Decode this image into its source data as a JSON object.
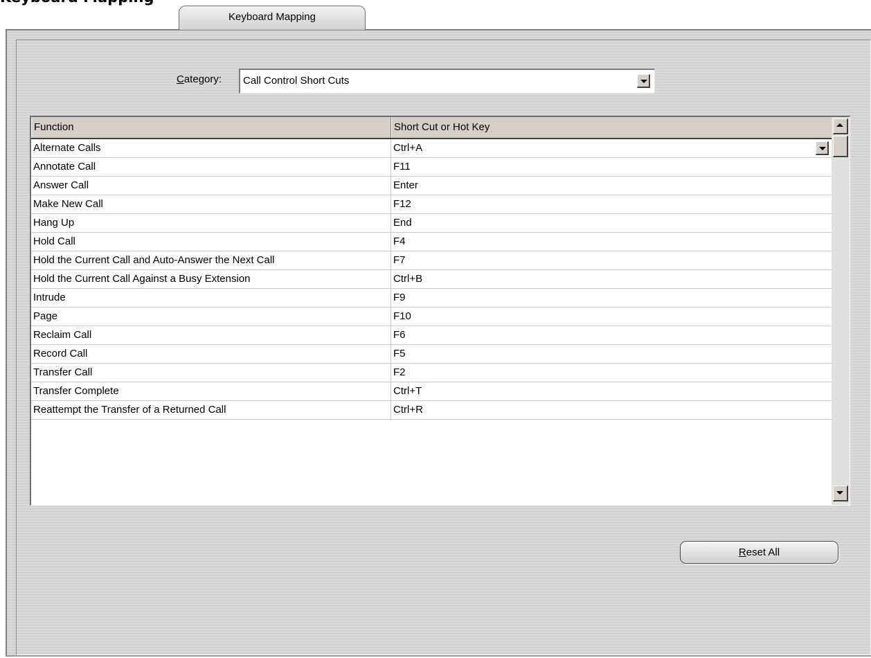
{
  "header": {
    "title": "Keyboard Mapping"
  },
  "tab": {
    "label": "Keyboard Mapping"
  },
  "category": {
    "label_mnemonic": "C",
    "label_rest": "ategory:",
    "value": "Call Control Short Cuts"
  },
  "table": {
    "columns": [
      "Function",
      "Short Cut or Hot Key"
    ],
    "rows": [
      [
        "Alternate Calls",
        "Ctrl+A"
      ],
      [
        "Annotate Call",
        "F11"
      ],
      [
        "Answer Call",
        "Enter"
      ],
      [
        "Make New Call",
        "F12"
      ],
      [
        "Hang Up",
        "End"
      ],
      [
        "Hold Call",
        "F4"
      ],
      [
        "Hold the Current Call and Auto-Answer the Next Call",
        "F7"
      ],
      [
        "Hold the Current Call Against a Busy Extension",
        "Ctrl+B"
      ],
      [
        "Intrude",
        "F9"
      ],
      [
        "Page",
        "F10"
      ],
      [
        "Reclaim Call",
        "F6"
      ],
      [
        "Record Call",
        "F5"
      ],
      [
        "Transfer Call",
        "F2"
      ],
      [
        "Transfer Complete",
        "Ctrl+T"
      ],
      [
        "Reattempt the Transfer of a Returned Call",
        "Ctrl+R"
      ]
    ]
  },
  "buttons": {
    "reset_mnemonic": "R",
    "reset_rest": "eset All"
  },
  "icons": {
    "dropdown": "chevron-down-icon",
    "scroll_up": "arrow-up-icon",
    "scroll_down": "arrow-down-icon"
  }
}
